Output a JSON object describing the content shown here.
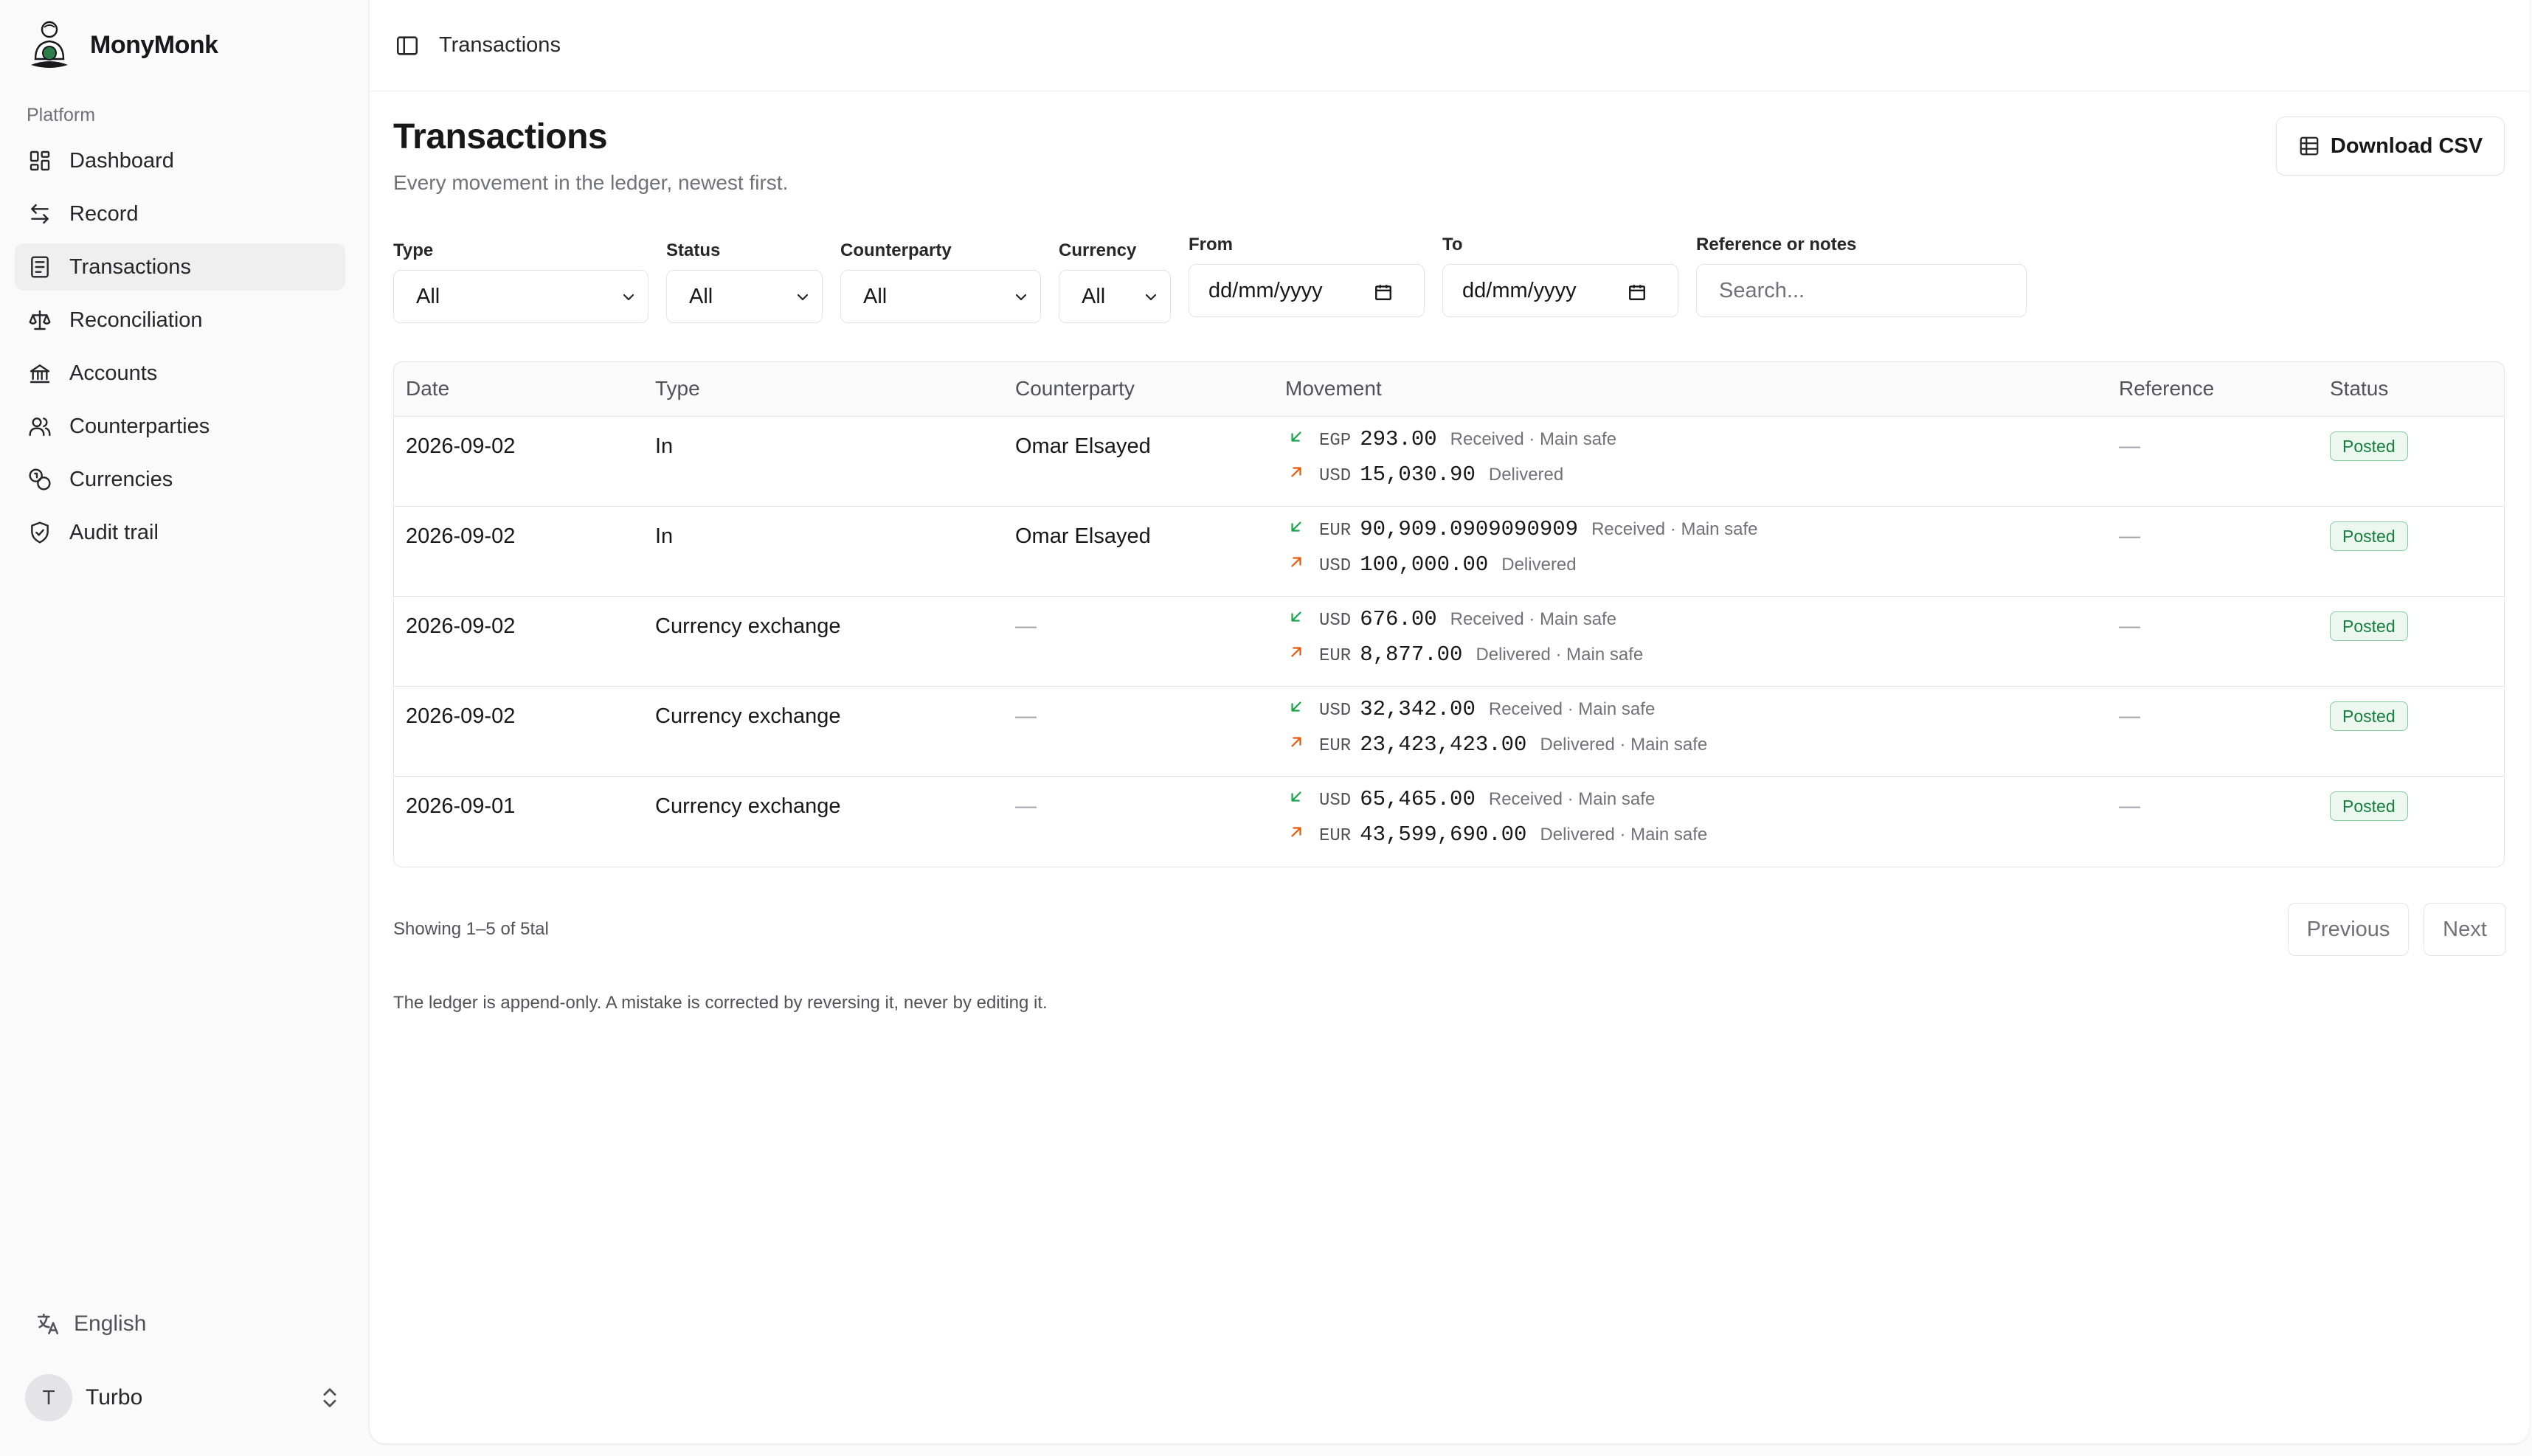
{
  "brand": {
    "name": "MonyMonk"
  },
  "sidebar": {
    "group_label": "Platform",
    "items": [
      {
        "label": "Dashboard",
        "icon": "dashboard-grid-icon",
        "active": false
      },
      {
        "label": "Record",
        "icon": "arrows-left-right-icon",
        "active": false
      },
      {
        "label": "Transactions",
        "icon": "receipt-icon",
        "active": true
      },
      {
        "label": "Reconciliation",
        "icon": "scale-icon",
        "active": false
      },
      {
        "label": "Accounts",
        "icon": "bank-icon",
        "active": false
      },
      {
        "label": "Counterparties",
        "icon": "users-icon",
        "active": false
      },
      {
        "label": "Currencies",
        "icon": "coins-icon",
        "active": false
      },
      {
        "label": "Audit trail",
        "icon": "shield-check-icon",
        "active": false
      }
    ],
    "language": "English",
    "user": {
      "initial": "T",
      "name": "Turbo"
    }
  },
  "header": {
    "breadcrumb": "Transactions"
  },
  "page": {
    "title": "Transactions",
    "subtitle": "Every movement in the ledger, newest first.",
    "download_label": "Download CSV"
  },
  "filters": {
    "type": {
      "label": "Type",
      "value": "All"
    },
    "status": {
      "label": "Status",
      "value": "All"
    },
    "counterparty": {
      "label": "Counterparty",
      "value": "All"
    },
    "currency": {
      "label": "Currency",
      "value": "All"
    },
    "from": {
      "label": "From",
      "value": "dd/mm/yyyy"
    },
    "to": {
      "label": "To",
      "value": "dd/mm/yyyy"
    },
    "reference": {
      "label": "Reference or notes",
      "placeholder": "Search..."
    }
  },
  "table": {
    "columns": [
      "Date",
      "Type",
      "Counterparty",
      "Movement",
      "Reference",
      "Status"
    ],
    "rows": [
      {
        "date": "2026-09-02",
        "type": "In",
        "counterparty": "Omar Elsayed",
        "in": {
          "currency": "EGP",
          "amount": "293.00",
          "note": "Received · Main safe"
        },
        "out": {
          "currency": "USD",
          "amount": "15,030.90",
          "note": "Delivered"
        },
        "reference": "—",
        "status": "Posted"
      },
      {
        "date": "2026-09-02",
        "type": "In",
        "counterparty": "Omar Elsayed",
        "in": {
          "currency": "EUR",
          "amount": "90,909.0909090909",
          "note": "Received · Main safe"
        },
        "out": {
          "currency": "USD",
          "amount": "100,000.00",
          "note": "Delivered"
        },
        "reference": "—",
        "status": "Posted"
      },
      {
        "date": "2026-09-02",
        "type": "Currency exchange",
        "counterparty": "—",
        "in": {
          "currency": "USD",
          "amount": "676.00",
          "note": "Received · Main safe"
        },
        "out": {
          "currency": "EUR",
          "amount": "8,877.00",
          "note": "Delivered · Main safe"
        },
        "reference": "—",
        "status": "Posted"
      },
      {
        "date": "2026-09-02",
        "type": "Currency exchange",
        "counterparty": "—",
        "in": {
          "currency": "USD",
          "amount": "32,342.00",
          "note": "Received · Main safe"
        },
        "out": {
          "currency": "EUR",
          "amount": "23,423,423.00",
          "note": "Delivered · Main safe"
        },
        "reference": "—",
        "status": "Posted"
      },
      {
        "date": "2026-09-01",
        "type": "Currency exchange",
        "counterparty": "—",
        "in": {
          "currency": "USD",
          "amount": "65,465.00",
          "note": "Received · Main safe"
        },
        "out": {
          "currency": "EUR",
          "amount": "43,599,690.00",
          "note": "Delivered · Main safe"
        },
        "reference": "—",
        "status": "Posted"
      }
    ]
  },
  "pagination": {
    "showing": "Showing 1–5 of 5tal",
    "previous": "Previous",
    "next": "Next"
  },
  "footnote": "The ledger is append-only. A mistake is corrected by reversing it, never by editing it.",
  "colors": {
    "in_arrow": "#16a34a",
    "out_arrow": "#ea580c",
    "posted_badge": "#15803d"
  }
}
